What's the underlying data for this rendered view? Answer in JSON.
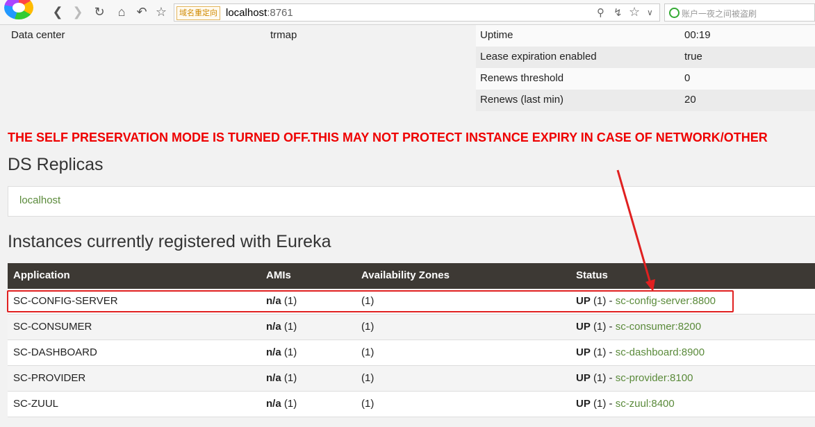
{
  "browser": {
    "redirect_tag": "域名重定向",
    "url_host": "localhost",
    "url_port": ":8761",
    "search_placeholder": "账户一夜之间被盗刷"
  },
  "left_info": {
    "data_center_label": "Data center",
    "data_center_value": "trmap"
  },
  "info_rows": [
    {
      "label": "Uptime",
      "value": "00:19"
    },
    {
      "label": "Lease expiration enabled",
      "value": "true"
    },
    {
      "label": "Renews threshold",
      "value": "0"
    },
    {
      "label": "Renews (last min)",
      "value": "20"
    }
  ],
  "warning": "THE SELF PRESERVATION MODE IS TURNED OFF.THIS MAY NOT PROTECT INSTANCE EXPIRY IN CASE OF NETWORK/OTHER",
  "replicas": {
    "title": "DS Replicas",
    "link": "localhost"
  },
  "instances": {
    "title": "Instances currently registered with Eureka",
    "headers": [
      "Application",
      "AMIs",
      "Availability Zones",
      "Status"
    ],
    "rows": [
      {
        "app": "SC-CONFIG-SERVER",
        "ami_bold": "n/a",
        "ami_count": " (1)",
        "zones": "(1)",
        "status_bold": "UP",
        "status_count": " (1) - ",
        "status_link": "sc-config-server:8800"
      },
      {
        "app": "SC-CONSUMER",
        "ami_bold": "n/a",
        "ami_count": " (1)",
        "zones": "(1)",
        "status_bold": "UP",
        "status_count": " (1) - ",
        "status_link": "sc-consumer:8200"
      },
      {
        "app": "SC-DASHBOARD",
        "ami_bold": "n/a",
        "ami_count": " (1)",
        "zones": "(1)",
        "status_bold": "UP",
        "status_count": " (1) - ",
        "status_link": "sc-dashboard:8900"
      },
      {
        "app": "SC-PROVIDER",
        "ami_bold": "n/a",
        "ami_count": " (1)",
        "zones": "(1)",
        "status_bold": "UP",
        "status_count": " (1) - ",
        "status_link": "sc-provider:8100"
      },
      {
        "app": "SC-ZUUL",
        "ami_bold": "n/a",
        "ami_count": " (1)",
        "zones": "(1)",
        "status_bold": "UP",
        "status_count": " (1) - ",
        "status_link": "sc-zuul:8400"
      }
    ]
  },
  "colors": {
    "warning": "#e00000",
    "link": "#5a8a3a",
    "table_header": "#3d3934",
    "annotation": "#e02020"
  }
}
